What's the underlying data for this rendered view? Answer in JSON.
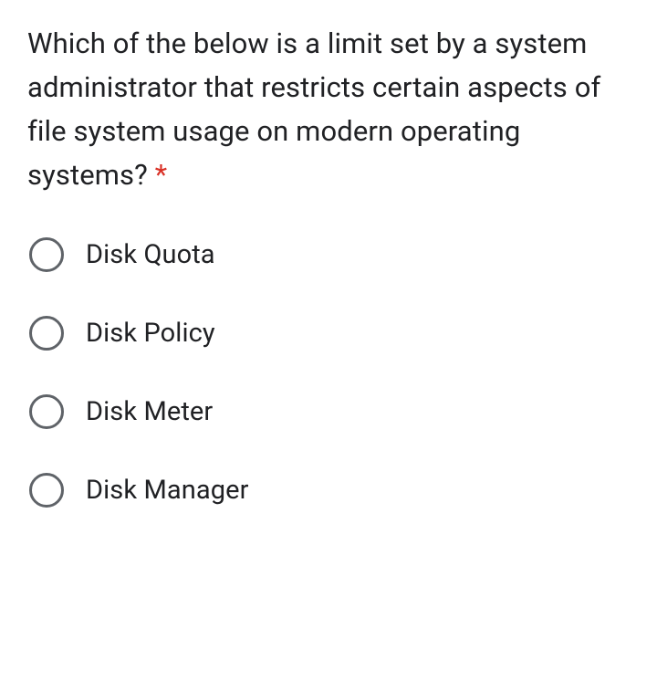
{
  "question": {
    "text": "Which of the below is a limit set by a system administrator that restricts certain aspects of file system usage on modern operating systems?",
    "required_marker": "*"
  },
  "options": [
    {
      "label": "Disk Quota"
    },
    {
      "label": "Disk Policy"
    },
    {
      "label": "Disk Meter"
    },
    {
      "label": "Disk Manager"
    }
  ]
}
